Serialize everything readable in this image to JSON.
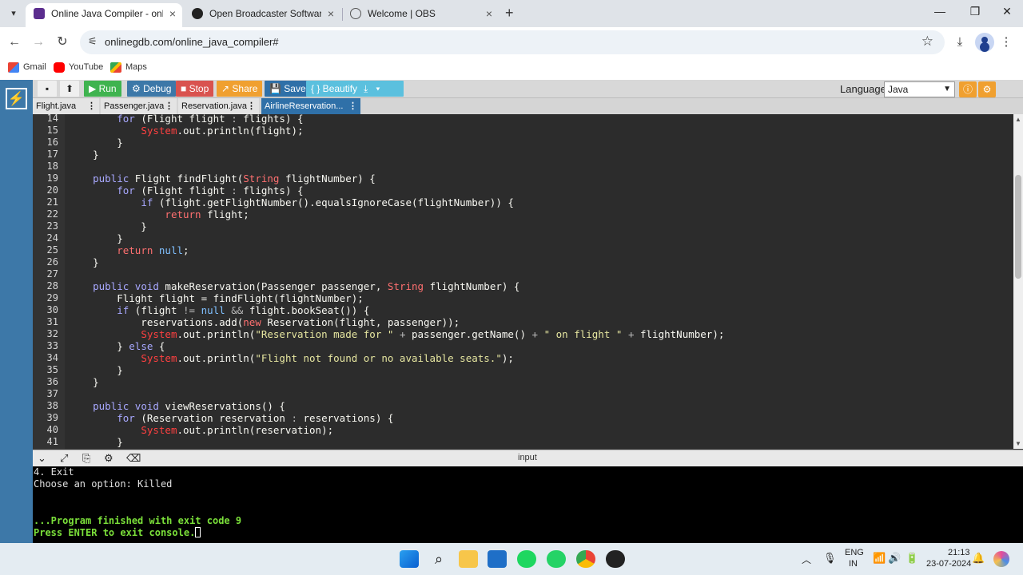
{
  "browser": {
    "tabs": [
      {
        "label": "Online Java Compiler - online e",
        "active": true,
        "icon": "onlinegdb-icon"
      },
      {
        "label": "Open Broadcaster Software | OB",
        "active": false,
        "icon": "obs-icon"
      },
      {
        "label": "Welcome | OBS",
        "active": false,
        "icon": "globe-icon"
      }
    ],
    "url": "onlinegdb.com/online_java_compiler#",
    "bookmarks": [
      {
        "label": "Gmail",
        "icon": "gmail-icon"
      },
      {
        "label": "YouTube",
        "icon": "youtube-icon"
      },
      {
        "label": "Maps",
        "icon": "maps-icon"
      }
    ]
  },
  "toolbar": {
    "run": "▶ Run",
    "debug": "⚙ Debug",
    "stop": "■ Stop",
    "share": "↗ Share",
    "save": "💾 Save",
    "beautify": "{ } Beautify",
    "language_label": "Language",
    "language_value": "Java",
    "colors": {
      "run": "#3fb34f",
      "debug": "#3d78a8",
      "stop": "#d9534f",
      "share": "#f0a030",
      "save": "#2f70a8",
      "beautify": "#5bc0de",
      "download": "#5bc0de"
    }
  },
  "files": [
    {
      "label": "Flight.java",
      "active": false
    },
    {
      "label": "Passenger.java",
      "active": false
    },
    {
      "label": "Reservation.java",
      "active": false
    },
    {
      "label": "AirlineReservation...",
      "active": true
    }
  ],
  "editor": {
    "line_numbers": [
      "14",
      "15",
      "16",
      "17",
      "18",
      "19",
      "20",
      "21",
      "22",
      "23",
      "24",
      "25",
      "26",
      "27",
      "28",
      "29",
      "30",
      "31",
      "32",
      "33",
      "34",
      "35",
      "36",
      "37",
      "38",
      "39",
      "40",
      "41"
    ],
    "lines": [
      "        for (Flight flight : flights) {",
      "            System.out.println(flight);",
      "        }",
      "    }",
      "",
      "    public Flight findFlight(String flightNumber) {",
      "        for (Flight flight : flights) {",
      "            if (flight.getFlightNumber().equalsIgnoreCase(flightNumber)) {",
      "                return flight;",
      "            }",
      "        }",
      "        return null;",
      "    }",
      "",
      "    public void makeReservation(Passenger passenger, String flightNumber) {",
      "        Flight flight = findFlight(flightNumber);",
      "        if (flight != null && flight.bookSeat()) {",
      "            reservations.add(new Reservation(flight, passenger));",
      "            System.out.println(\"Reservation made for \" + passenger.getName() + \" on flight \" + flightNumber);",
      "        } else {",
      "            System.out.println(\"Flight not found or no available seats.\");",
      "        }",
      "    }",
      "",
      "    public void viewReservations() {",
      "        for (Reservation reservation : reservations) {",
      "            System.out.println(reservation);",
      "        }"
    ]
  },
  "console": {
    "title": "input",
    "lines": [
      "4. Exit",
      "Choose an option: Killed",
      "",
      "",
      "...Program finished with exit code 9",
      "Press ENTER to exit console."
    ]
  },
  "taskbar": {
    "lang": "ENG",
    "region": "IN",
    "time": "21:13",
    "date": "23-07-2024"
  }
}
